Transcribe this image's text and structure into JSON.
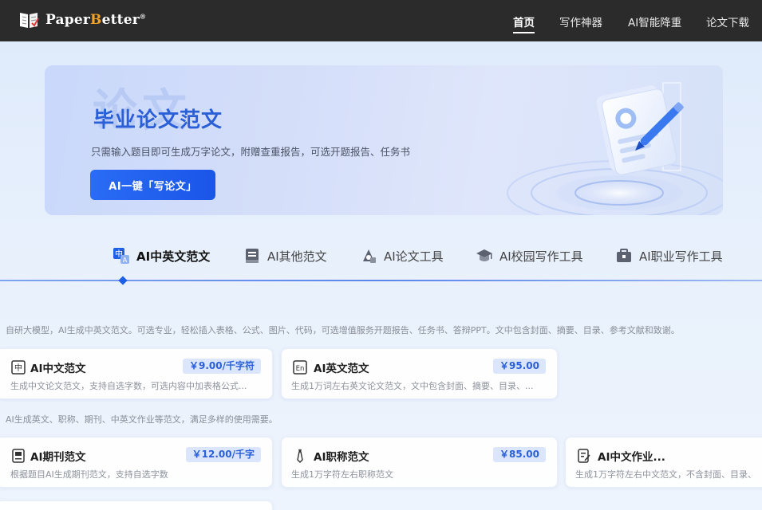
{
  "brand": {
    "name_pre": "Paper",
    "name_accent": "B",
    "name_post": "etter",
    "reg": "®",
    "accent_color": "#f0a229"
  },
  "nav": {
    "links": [
      {
        "label": "首页",
        "active": true
      },
      {
        "label": "写作神器"
      },
      {
        "label": "AI智能降重"
      },
      {
        "label": "论文下载"
      }
    ]
  },
  "banner": {
    "watermark": "论文",
    "title": "毕业论文范文",
    "subtitle": "只需输入题目即可生成万字论文，附赠查重报告，可选开题报告、任务书",
    "button_label": "AI一键「写论文」"
  },
  "tabs": [
    {
      "label": "AI中英文范文",
      "icon": "translate-icon",
      "active": true
    },
    {
      "label": "AI其他范文",
      "icon": "book-icon"
    },
    {
      "label": "AI论文工具",
      "icon": "tools-icon"
    },
    {
      "label": "AI校园写作工具",
      "icon": "graduation-cap-icon"
    },
    {
      "label": "AI职业写作工具",
      "icon": "briefcase-icon"
    }
  ],
  "sections": [
    {
      "desc": "自研大模型，AI生成中英文范文。可选专业，轻松插入表格、公式、图片、代码，可选增值服务开题报告、任务书、答辩PPT。文中包含封面、摘要、目录、参考文献和致谢。",
      "cards": [
        {
          "title": "AI中文范文",
          "price": "￥9.00/千字符",
          "desc": "生成中文论文范文，支持自选字数，可选内容中加表格公式...",
          "icon": "zh-icon"
        },
        {
          "title": "AI英文范文",
          "price": "￥95.00",
          "desc": "生成1万词左右英文论文范文，文中包含封面、摘要、目录、...",
          "icon": "en-icon"
        }
      ]
    },
    {
      "desc": "AI生成英文、职称、期刊、中英文作业等范文，满足多样的使用需要。",
      "cards": [
        {
          "title": "AI期刊范文",
          "price": "￥12.00/千字",
          "desc": "根据题目AI生成期刊范文，支持自选字数",
          "icon": "journal-icon"
        },
        {
          "title": "AI职称范文",
          "price": "￥85.00",
          "desc": "生成1万字符左右职称范文",
          "icon": "tie-icon"
        },
        {
          "title": "AI中文作业...",
          "price": "",
          "desc": "生成1万字符左右中文范文，不含封面、目录、",
          "icon": "homework-icon"
        }
      ]
    }
  ]
}
